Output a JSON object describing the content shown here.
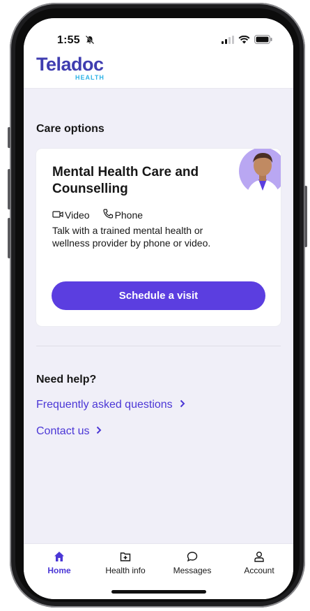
{
  "status_bar": {
    "time": "1:55"
  },
  "brand": {
    "name": "Teladoc",
    "sub": "HEALTH"
  },
  "care": {
    "section_title": "Care options",
    "card_title": "Mental Health Care and Counselling",
    "modes": [
      "Video",
      "Phone"
    ],
    "description": "Talk with a trained mental health or wellness provider by phone or video.",
    "button_label": "Schedule a visit"
  },
  "help": {
    "title": "Need help?",
    "links": [
      "Frequently asked questions",
      "Contact us"
    ]
  },
  "tabs": [
    "Home",
    "Health info",
    "Messages",
    "Account"
  ],
  "colors": {
    "accent": "#5b3ee0",
    "link": "#4b37d6",
    "brand": "#3f3db0",
    "background": "#f0eff8"
  },
  "icons": [
    "silent-bell-icon",
    "signal-icon",
    "wifi-icon",
    "battery-icon",
    "video-icon",
    "phone-icon",
    "chevron-right-icon",
    "home-icon",
    "health-info-icon",
    "messages-icon",
    "account-icon"
  ]
}
